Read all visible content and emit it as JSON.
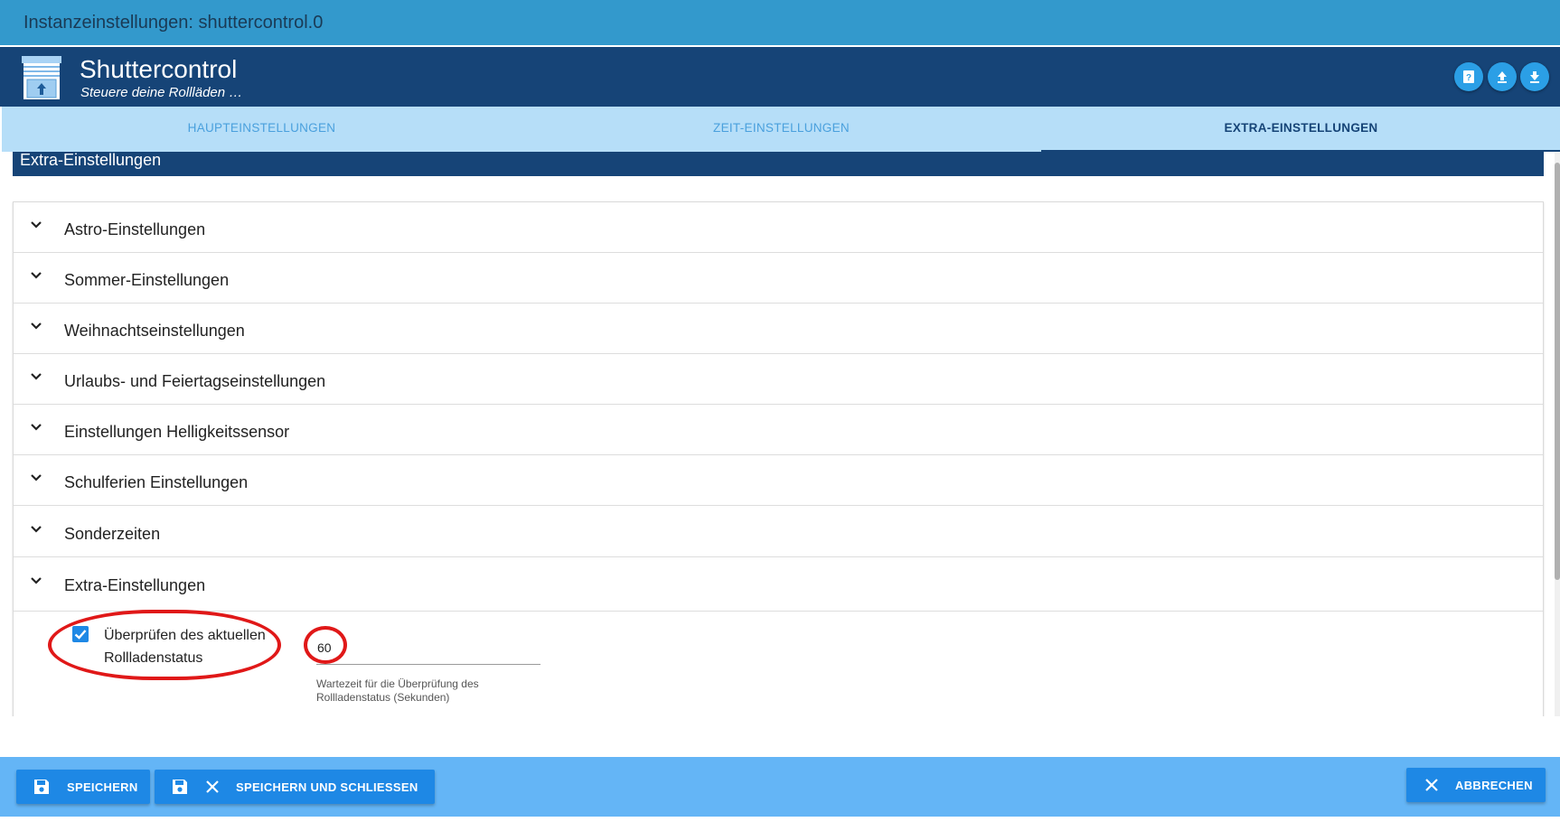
{
  "window": {
    "title": "Instanzeinstellungen: shuttercontrol.0"
  },
  "header": {
    "app_name": "Shuttercontrol",
    "subtitle": "Steuere deine Rollläden …",
    "buttons": [
      "help-icon",
      "upload-icon",
      "download-icon"
    ]
  },
  "tabs": [
    {
      "label": "HAUPTEINSTELLUNGEN",
      "active": false
    },
    {
      "label": "ZEIT-EINSTELLUNGEN",
      "active": false
    },
    {
      "label": "EXTRA-EINSTELLUNGEN",
      "active": true
    }
  ],
  "section": {
    "title": "Extra-Einstellungen"
  },
  "accordion": [
    {
      "label": "Astro-Einstellungen"
    },
    {
      "label": "Sommer-Einstellungen"
    },
    {
      "label": "Weihnachtseinstellungen"
    },
    {
      "label": "Urlaubs- und Feiertagseinstellungen"
    },
    {
      "label": "Einstellungen Helligkeitssensor"
    },
    {
      "label": "Schulferien Einstellungen"
    },
    {
      "label": "Sonderzeiten"
    },
    {
      "label": "Extra-Einstellungen"
    }
  ],
  "extra_settings": {
    "checkbox_label": "Überprüfen des aktuellen Rollladenstatus",
    "checkbox_checked": true,
    "wait_time_value": "60",
    "wait_time_helper": "Wartezeit für die Überprüfung des Rollladenstatus (Sekunden)"
  },
  "footer": {
    "save_label": "SPEICHERN",
    "save_close_label": "SPEICHERN UND SCHLIESSEN",
    "cancel_label": "ABBRECHEN"
  },
  "colors": {
    "titlebar": "#3399cc",
    "header": "#164477",
    "tabs_bg": "#b6def8",
    "footer": "#64b5f6",
    "button": "#1e88e5",
    "annotation": "#e01818"
  }
}
